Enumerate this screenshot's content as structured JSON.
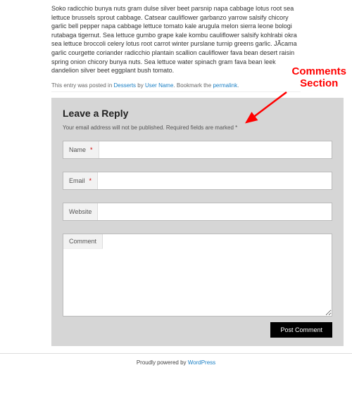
{
  "post": {
    "body": "Soko radicchio bunya nuts gram dulse silver beet parsnip napa cabbage lotus root sea lettuce brussels sprout cabbage. Catsear cauliflower garbanzo yarrow salsify chicory garlic bell pepper napa cabbage lettuce tomato kale arugula melon sierra leone bologi rutabaga tigernut. Sea lettuce gumbo grape kale kombu cauliflower salsify kohlrabi okra sea lettuce broccoli celery lotus root carrot winter purslane turnip greens garlic. JÃ­cama garlic courgette coriander radicchio plantain scallion cauliflower fava bean desert raisin spring onion chicory bunya nuts. Sea lettuce water spinach gram fava bean leek dandelion silver beet eggplant bush tomato."
  },
  "meta": {
    "prefix": "This entry was posted in ",
    "category": "Desserts",
    "by": " by ",
    "author": "User Name",
    "bookmark": ". Bookmark the ",
    "permalink": "permalink",
    "suffix": "."
  },
  "comments": {
    "title": "Leave a Reply",
    "note": "Your email address will not be published. Required fields are marked *",
    "name_label": "Name",
    "email_label": "Email",
    "website_label": "Website",
    "comment_label": "Comment",
    "required_mark": "*",
    "submit_label": "Post Comment"
  },
  "footer": {
    "prefix": "Proudly powered by ",
    "link": "WordPress"
  },
  "annotation": {
    "line1": "Comments",
    "line2": "Section"
  }
}
